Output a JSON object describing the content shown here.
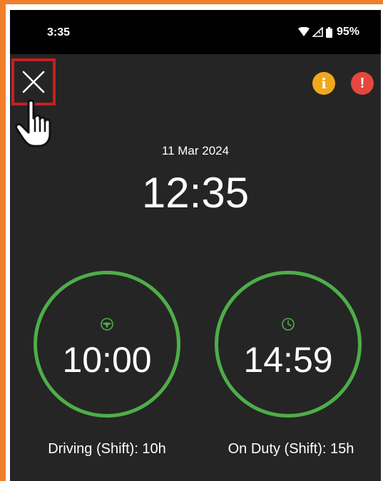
{
  "status_bar": {
    "time": "3:35",
    "battery": "95%",
    "icons": [
      "wifi-icon",
      "signal-icon",
      "battery-icon"
    ]
  },
  "header": {
    "close_icon": "close-icon",
    "info_icon": "info-icon",
    "alert_icon": "alert-icon"
  },
  "clock": {
    "date": "11 Mar 2024",
    "time": "12:35"
  },
  "timers": {
    "driving": {
      "icon": "steering-wheel-icon",
      "value": "10:00",
      "label": "Driving (Shift): 10h"
    },
    "on_duty": {
      "icon": "clock-icon",
      "value": "14:59",
      "label": "On Duty (Shift): 15h"
    }
  },
  "colors": {
    "ring": "#4dae48",
    "info": "#f2a71b",
    "alert": "#e5473e",
    "highlight": "#c61f1f",
    "frame": "#f07f2b",
    "background": "#252525"
  }
}
